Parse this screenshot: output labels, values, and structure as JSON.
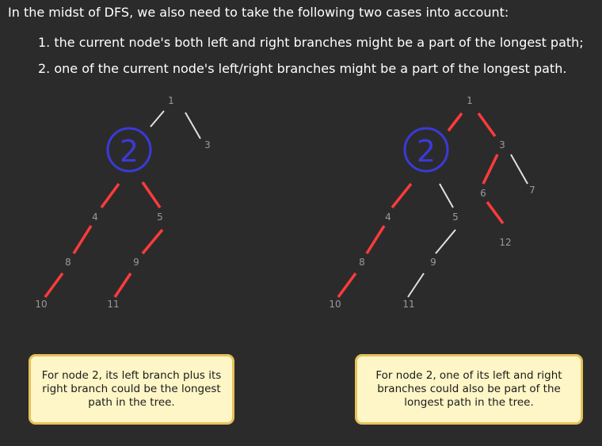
{
  "intro": "In the midst of DFS, we also need to take the following two cases into account:",
  "cases": [
    "1. the current node's both left and right branches might be a part of the longest path;",
    "2. one of the current node's left/right branches might be a part of the longest path."
  ],
  "colors": {
    "background": "#2b2b2b",
    "highlight_edge": "#ff3b3b",
    "normal_edge": "#e0e0e0",
    "current_node": "#3a3ad8",
    "node_label": "#9a9a9a",
    "note_fill": "#fff6c7",
    "note_border": "#e6c25a"
  },
  "left_tree": {
    "nodes": [
      "1",
      "2",
      "3",
      "4",
      "5",
      "8",
      "9",
      "10",
      "11"
    ],
    "highlighted_node": "2",
    "highlighted_path": [
      "10",
      "8",
      "4",
      "2",
      "5",
      "9",
      "11"
    ],
    "note": "For node 2, its left branch plus its right branch could be the longest path in the tree."
  },
  "right_tree": {
    "nodes": [
      "1",
      "2",
      "3",
      "4",
      "5",
      "6",
      "7",
      "8",
      "9",
      "10",
      "11",
      "12"
    ],
    "highlighted_node": "2",
    "highlighted_path": [
      "10",
      "8",
      "4",
      "2",
      "1",
      "3",
      "6",
      "12"
    ],
    "note": "For node 2, one of its left and right branches could also be part of the longest path in the tree."
  }
}
